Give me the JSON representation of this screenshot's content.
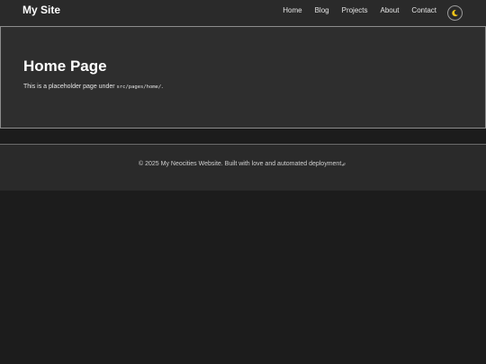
{
  "header": {
    "site_title": "My Site",
    "nav": [
      "Home",
      "Blog",
      "Projects",
      "About",
      "Contact"
    ],
    "theme_toggle_icon": "moon-icon"
  },
  "main": {
    "title": "Home Page",
    "description_before": "This is a placeholder page under ",
    "description_code": "src/pages/home/",
    "description_after": "."
  },
  "footer": {
    "text": "© 2025 My Neocities Website. Built with love and automated deployment.",
    "icon": "rocket-icon"
  },
  "colors": {
    "background": "#1c1c1c",
    "surface": "#2e2e2e",
    "header": "#2a2a2a",
    "moon": "#f0c419"
  }
}
